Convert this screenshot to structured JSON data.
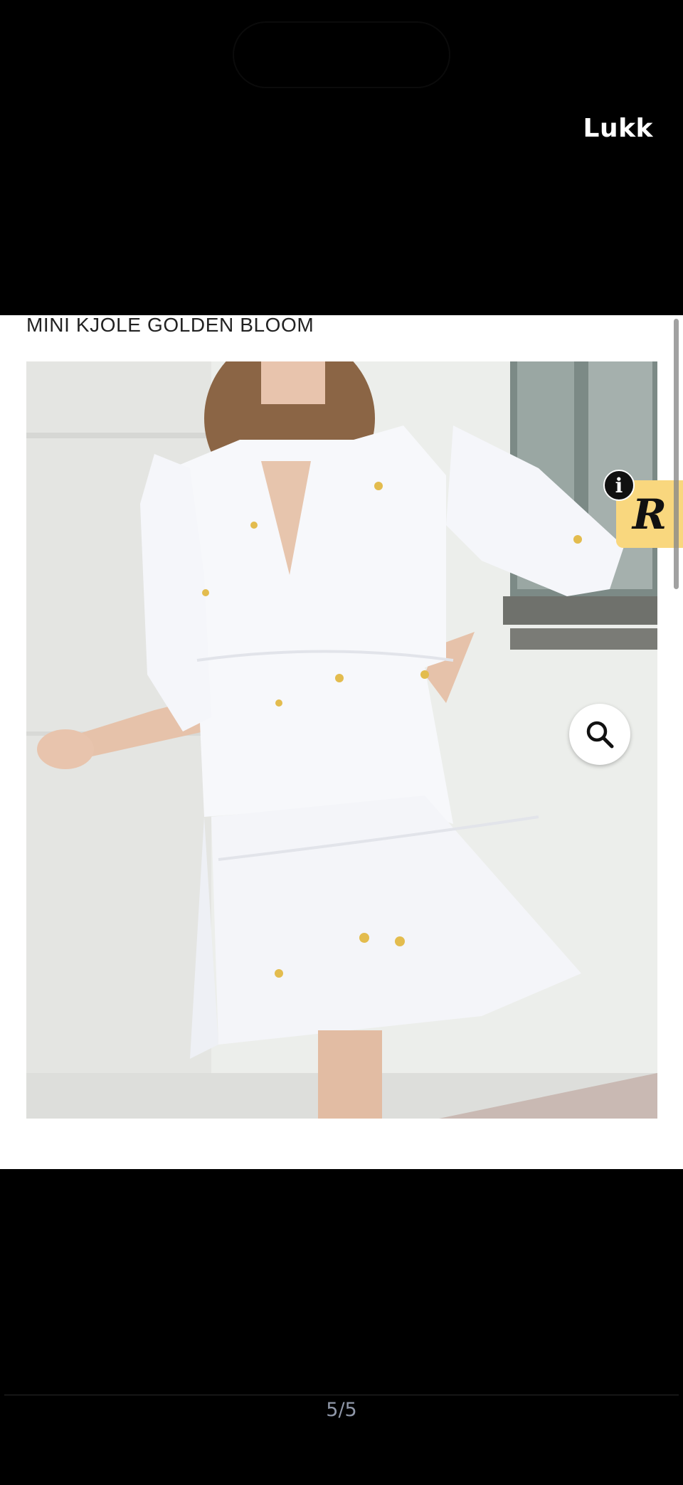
{
  "header": {
    "close_label": "Lukk"
  },
  "product": {
    "title": "MINI KJOLE GOLDEN BLOOM"
  },
  "badge": {
    "info_glyph": "i",
    "logo_letter": "R"
  },
  "pager": {
    "text": "5/5"
  },
  "colors": {
    "badge_bg": "#f9d77e",
    "background": "#000000"
  }
}
